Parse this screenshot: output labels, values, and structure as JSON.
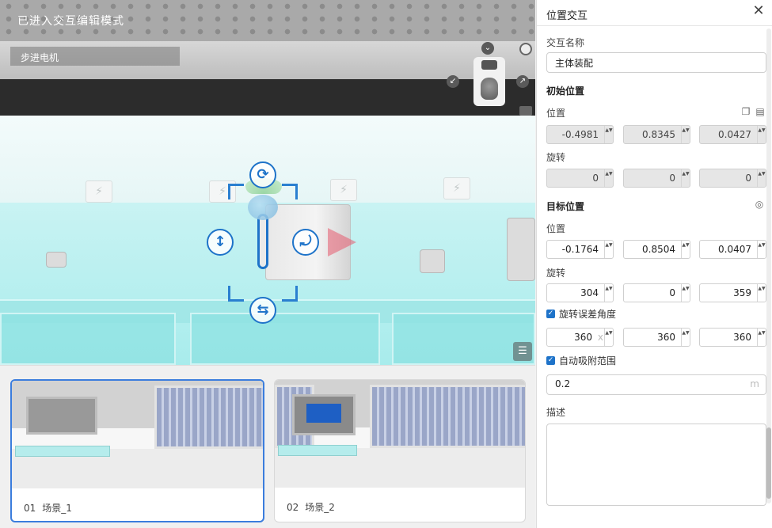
{
  "viewport": {
    "mode_title": "已进入交互编辑模式",
    "selected_object": "步进电机",
    "socket_glyph": "⚡",
    "gizmo": {
      "rotate_glyph": "⟳",
      "vertical_glyph": "↕",
      "flip_glyph": "⤾",
      "horizontal_glyph": "⇆"
    },
    "list_glyph": "☰",
    "orbit": {
      "up_glyph": "⌄",
      "left_glyph": "↙",
      "right_glyph": "↗"
    }
  },
  "scenes": [
    {
      "index": "01",
      "name": "场景_1",
      "active": true
    },
    {
      "index": "02",
      "name": "场景_2",
      "active": false
    }
  ],
  "panel": {
    "title": "位置交互",
    "close_glyph": "✕",
    "name_label": "交互名称",
    "name_value": "主体装配",
    "initial_section": "初始位置",
    "position_label": "位置",
    "rotation_label": "旋转",
    "initial_position": [
      "-0.4981",
      "0.8345",
      "0.0427"
    ],
    "initial_rotation": [
      "0",
      "0",
      "0"
    ],
    "target_section": "目标位置",
    "target_position": [
      "-0.1764",
      "0.8504",
      "0.0407"
    ],
    "target_rotation": [
      "304",
      "0",
      "359"
    ],
    "rotation_error_label": "旋转误差角度",
    "rotation_error": [
      "360",
      "360",
      "360"
    ],
    "rotation_error_unit": "x",
    "snap_label": "自动吸附范围",
    "snap_value": "0.2",
    "snap_unit": "m",
    "description_label": "描述",
    "copy_glyph": "❐",
    "paste_glyph": "▤",
    "locate_glyph": "◎",
    "check_glyph": "✓",
    "spin_glyph": "▲▼"
  }
}
